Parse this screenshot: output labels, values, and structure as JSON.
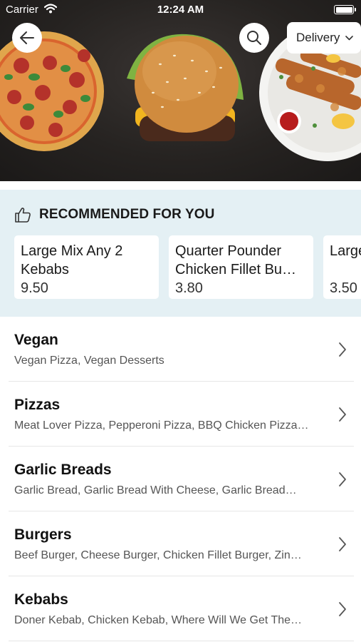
{
  "status_bar": {
    "carrier": "Carrier",
    "time": "12:24 AM"
  },
  "header": {
    "delivery_label": "Delivery"
  },
  "recommended": {
    "title": "RECOMMENDED FOR YOU",
    "items": [
      {
        "name": "Large Mix Any 2 Kebabs",
        "price": "9.50"
      },
      {
        "name": "Quarter Pounder Chicken Fillet Bu…",
        "price": "3.80"
      },
      {
        "name": "Large Chee…",
        "price": "3.50"
      }
    ]
  },
  "categories": [
    {
      "title": "Vegan",
      "subtitle": "Vegan Pizza, Vegan Desserts"
    },
    {
      "title": "Pizzas",
      "subtitle": "Meat Lover Pizza, Pepperoni Pizza, BBQ Chicken Pizza…"
    },
    {
      "title": "Garlic Breads",
      "subtitle": "Garlic Bread, Garlic Bread With Cheese, Garlic Bread…"
    },
    {
      "title": "Burgers",
      "subtitle": "Beef Burger, Cheese Burger, Chicken Fillet Burger, Zin…"
    },
    {
      "title": "Kebabs",
      "subtitle": "Doner Kebab, Chicken Kebab, Where Will We Get The…"
    }
  ],
  "icons": {
    "back": "arrow-left-icon",
    "search": "search-icon",
    "delivery_dropdown": "chevron-down-icon",
    "recommended": "thumbs-up-icon",
    "row_arrow": "chevron-right-icon"
  },
  "colors": {
    "recommended_background": "#e4f0f4",
    "card_background": "#ffffff",
    "hero_background": "#262321"
  }
}
